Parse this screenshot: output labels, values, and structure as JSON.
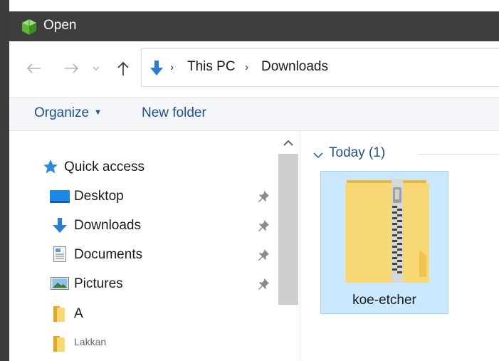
{
  "window": {
    "title": "Open"
  },
  "address_bar": {
    "crumbs": [
      "This PC",
      "Downloads"
    ]
  },
  "toolbar": {
    "organize_label": "Organize",
    "new_folder_label": "New folder"
  },
  "nav_pane": {
    "items": [
      {
        "label": "Quick access",
        "icon": "star-icon"
      },
      {
        "label": "Desktop",
        "icon": "desktop-icon",
        "pinned": true
      },
      {
        "label": "Downloads",
        "icon": "download-arrow-icon",
        "pinned": true
      },
      {
        "label": "Documents",
        "icon": "document-icon",
        "pinned": true
      },
      {
        "label": "Pictures",
        "icon": "pictures-icon",
        "pinned": true
      },
      {
        "label": "A",
        "icon": "folder-icon"
      },
      {
        "label": "Lakkan",
        "icon": "folder-icon"
      }
    ]
  },
  "content": {
    "group_label": "Today (1)",
    "files": [
      {
        "name": "koe-etcher",
        "type": "zip-folder",
        "selected": true
      }
    ]
  },
  "colors": {
    "titlebar": "#3e3e3e",
    "accent_text": "#1e4f8c",
    "selection_fill": "#cce8ff",
    "selection_border": "#99d1ff",
    "folder_yellow": "#f8d775",
    "download_blue": "#2b7cd3"
  }
}
